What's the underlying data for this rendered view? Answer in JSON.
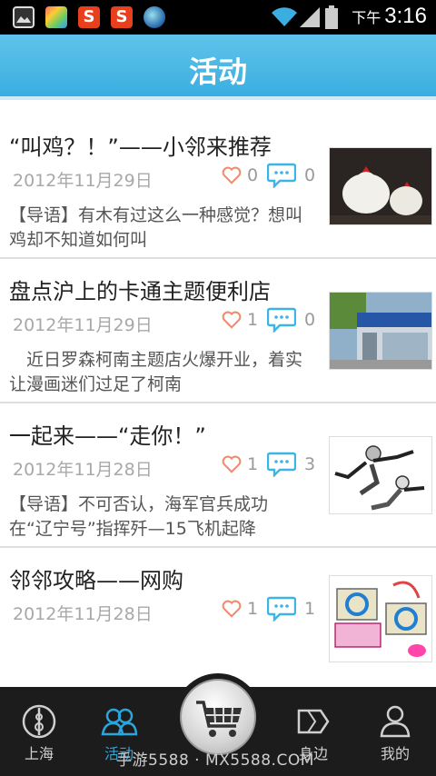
{
  "status_bar": {
    "time_prefix": "下午",
    "time": "3:16",
    "notification_icons": [
      "image-icon",
      "app-icon",
      "sogou-icon",
      "sogou-icon",
      "globe-icon"
    ],
    "system_icons": [
      "wifi-icon",
      "signal-icon",
      "battery-icon"
    ]
  },
  "header": {
    "title": "活动"
  },
  "articles": [
    {
      "title": "“叫鸡？！”——小邻来推荐",
      "date": "2012年11月29日",
      "likes": "0",
      "comments": "0",
      "summary": "【导语】有木有过这么一种感觉？想叫鸡却不知道如何叫",
      "thumbnail": "chicken-figurines"
    },
    {
      "title": "盘点沪上的卡通主题便利店",
      "date": "2012年11月29日",
      "likes": "1",
      "comments": "0",
      "summary": "　近日罗森柯南主题店火爆开业，着实让漫画迷们过足了柯南",
      "thumbnail": "convenience-store"
    },
    {
      "title": "一起来——“走你！”",
      "date": "2012年11月28日",
      "likes": "1",
      "comments": "3",
      "summary": "【导语】不可否认，海军官兵成功在“辽宁号”指挥歼—15飞机起降",
      "thumbnail": "zouni-cartoon"
    },
    {
      "title": "邻邻攻略——网购",
      "date": "2012年11月28日",
      "likes": "1",
      "comments": "1",
      "summary": "",
      "thumbnail": "online-shopping"
    }
  ],
  "bottom_nav": {
    "items": [
      {
        "label": "上海",
        "icon": "shanghai-tower-icon",
        "active": false
      },
      {
        "label": "活动",
        "icon": "people-icon",
        "active": true
      },
      {
        "label": "身边",
        "icon": "map-icon",
        "active": false
      },
      {
        "label": "我的",
        "icon": "user-icon",
        "active": false
      }
    ],
    "center_icon": "cart-icon"
  },
  "watermark": "手游5588 · MX5588.COM",
  "colors": {
    "accent": "#3aaee0",
    "heart": "#f08a6a",
    "bubble": "#3bb5e6"
  }
}
